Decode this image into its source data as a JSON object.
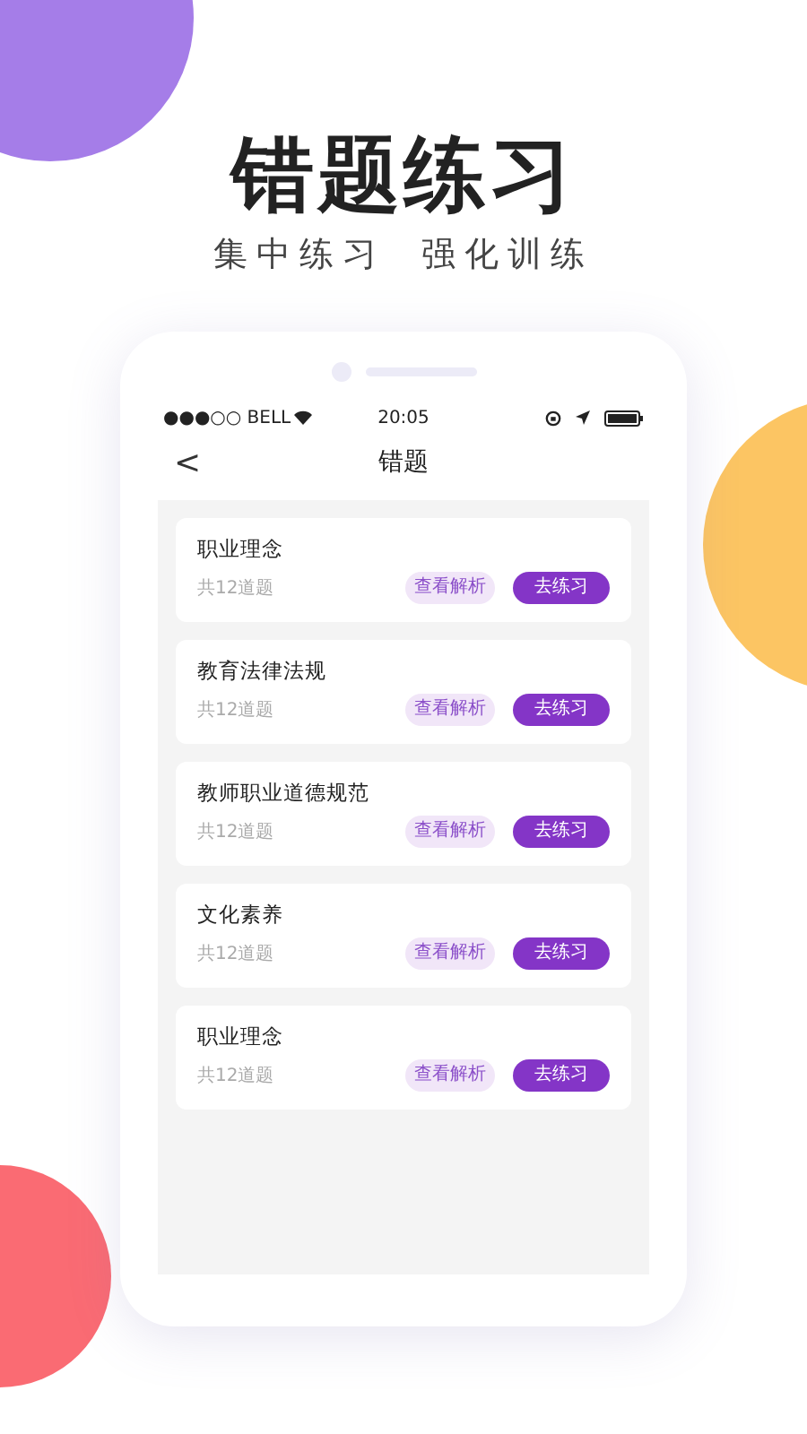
{
  "headline": "错题练习",
  "subtitle": [
    "集中练习",
    "强化训练"
  ],
  "status_bar": {
    "carrier": "●●●○○ BELL",
    "time": "20:05"
  },
  "nav": {
    "back": "<",
    "title": "错题"
  },
  "items": [
    {
      "title": "职业理念",
      "count": "共12道题",
      "review": "查看解析",
      "practice": "去练习"
    },
    {
      "title": "教育法律法规",
      "count": "共12道题",
      "review": "查看解析",
      "practice": "去练习"
    },
    {
      "title": "教师职业道德规范",
      "count": "共12道题",
      "review": "查看解析",
      "practice": "去练习"
    },
    {
      "title": "文化素养",
      "count": "共12道题",
      "review": "查看解析",
      "practice": "去练习"
    },
    {
      "title": "职业理念",
      "count": "共12道题",
      "review": "查看解析",
      "practice": "去练习"
    }
  ]
}
